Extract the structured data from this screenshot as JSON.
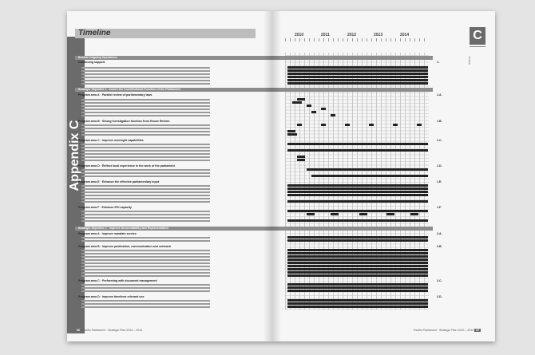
{
  "page": {
    "appendix_label": "Appendix C",
    "timeline_title": "Timeline",
    "chapter_tab": "C",
    "tab_label": "Timeline",
    "years": [
      "2010",
      "2011",
      "2012",
      "2013",
      "2014"
    ],
    "footer_left": {
      "page": "66",
      "publisher": "Pacific Parliament · Strategic Plan 2010 – 2014"
    },
    "footer_right": {
      "page": "67",
      "publisher": "Pacific Parliament · Strategic Plan 2010 – 2014"
    }
  },
  "sections": [
    {
      "label": "Sustain Ongoing Operations"
    },
    {
      "label": "Strategic Objective 1 · Assert the Constitutional Function of the Parliament"
    },
    {
      "label": "Strategic Objective 2 · Improve Accountability and Representation"
    }
  ],
  "programs": [
    {
      "label": "Continuing support",
      "code": "1."
    },
    {
      "label": "Program area A · Parallel review of parliamentary laws",
      "code": "1.A."
    },
    {
      "label": "Program area B · Strong Investigation function from House Reform",
      "code": "1.B."
    },
    {
      "label": "Program area C · Improve oversight capabilities",
      "code": "1.C."
    },
    {
      "label": "Program area D · Reflect local experience in the work of the parliament",
      "code": "1.D."
    },
    {
      "label": "Program area E · Enhance the effective parliamentary input",
      "code": "1.E."
    },
    {
      "label": "Program area F · Enhance IPU capacity",
      "code": "1.F."
    },
    {
      "label": "Program area A · Improve mandate service",
      "code": "2.A."
    },
    {
      "label": "Program area B · Improve publication, communication and outreach",
      "code": "2.B."
    },
    {
      "label": "Program area C · Performing with document management",
      "code": "2.C."
    },
    {
      "label": "Program area D · Improve timelines relevant use",
      "code": "2.D."
    }
  ]
}
